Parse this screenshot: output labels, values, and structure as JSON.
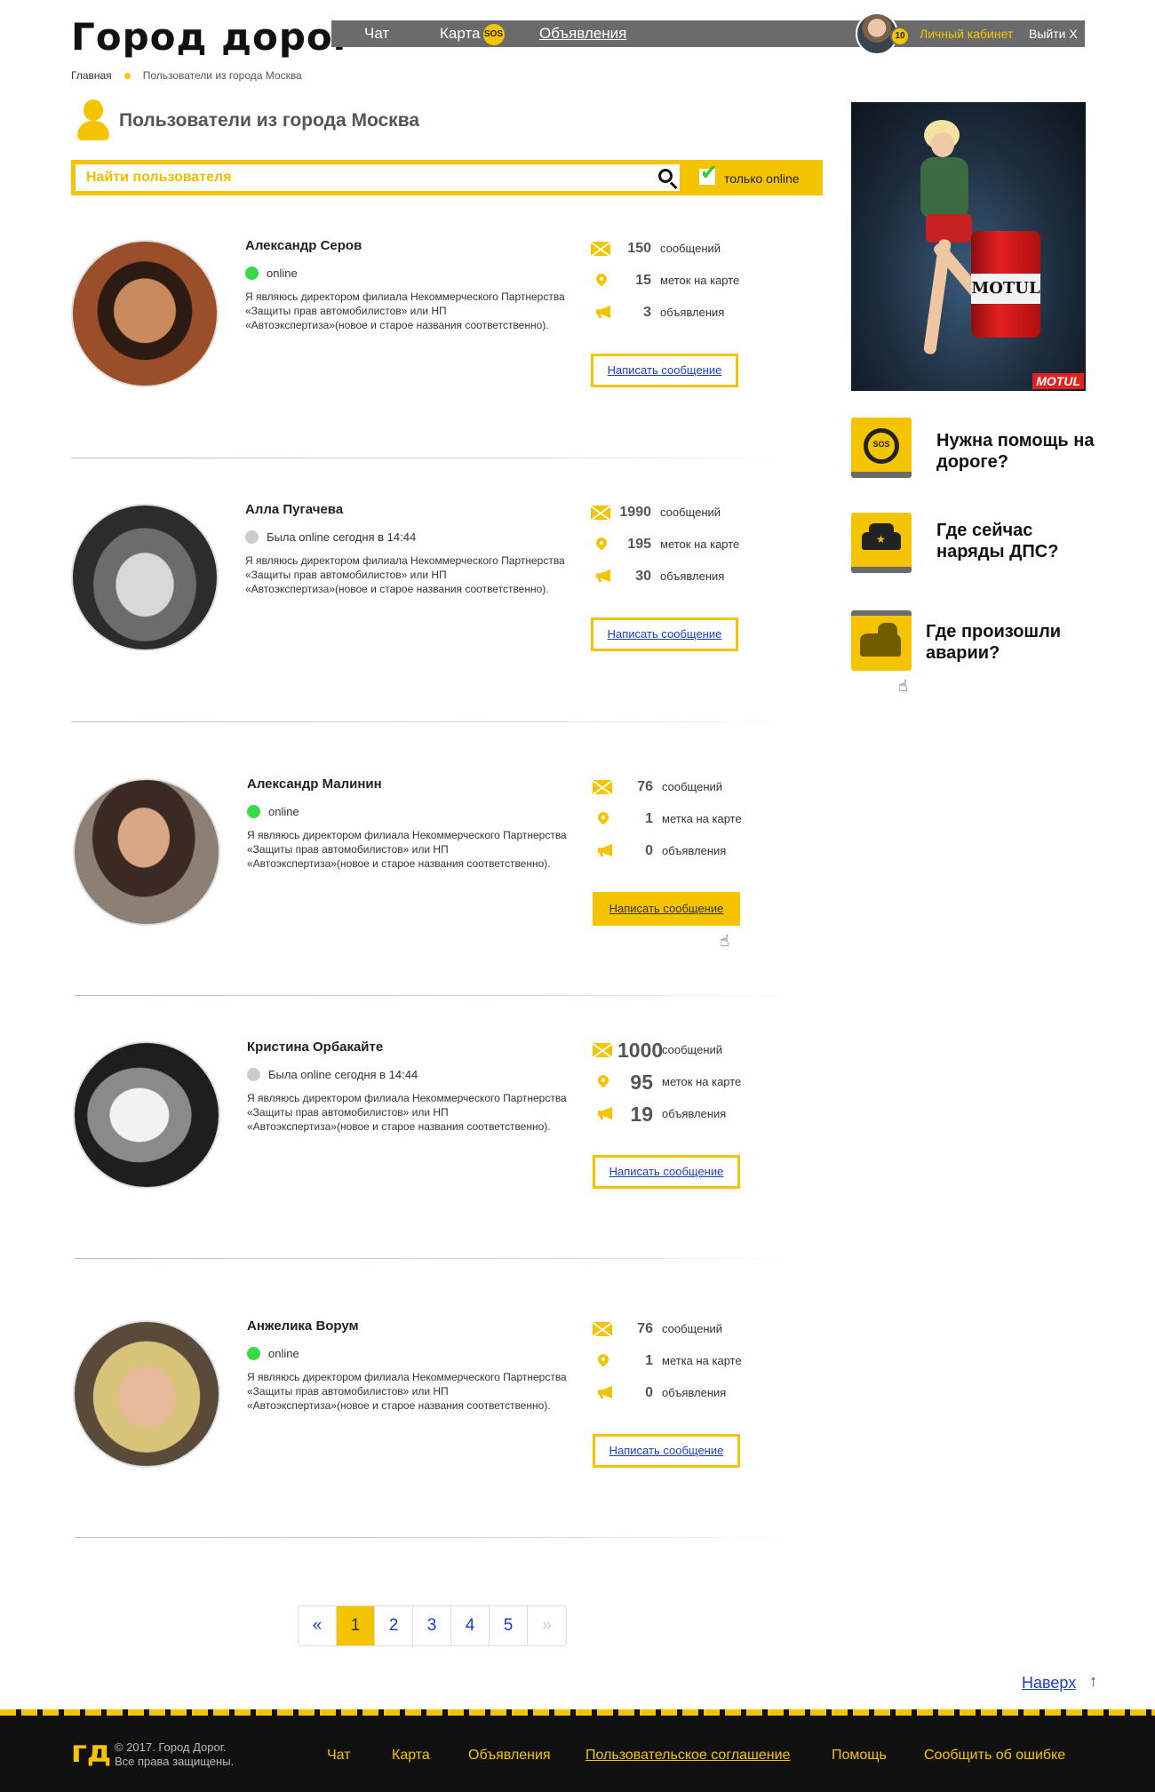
{
  "header": {
    "logo": "Город дорог",
    "nav": [
      {
        "label": "Чат"
      },
      {
        "label": "Карта",
        "badge": "SOS"
      },
      {
        "label": "Объявления"
      }
    ],
    "user": {
      "level": "10",
      "cabinet_label": "Личный кабинет",
      "logout_label": "Выйти Х"
    }
  },
  "breadcrumb": {
    "home": "Главная",
    "current": "Пользователи из города Москва"
  },
  "page_title": "Пользователи из города Москва",
  "search": {
    "placeholder": "Найти пользователя",
    "online_only_label": "только online",
    "online_only_checked": true
  },
  "users": [
    {
      "name": "Александр Серов",
      "status": "online",
      "is_online": true,
      "bio": "Я являюсь директором филиала Некоммерческого Партнерства «Защиты прав автомобилистов» или НП «Автоэкспертиза»(новое и старое названия соответственно).",
      "messages": "150",
      "messages_label": "сообщений",
      "marks": "15",
      "marks_label": "меток на карте",
      "ads": "3",
      "ads_label": "объявления",
      "write_label": "Написать сообщение"
    },
    {
      "name": "Алла Пугачева",
      "status": "Была online сегодня в 14:44",
      "is_online": false,
      "bio": "Я являюсь директором филиала Некоммерческого Партнерства «Защиты прав автомобилистов» или НП «Автоэкспертиза»(новое и старое названия соответственно).",
      "messages": "1990",
      "messages_label": "сообщений",
      "marks": "195",
      "marks_label": "меток на карте",
      "ads": "30",
      "ads_label": "объявления",
      "write_label": "Написать сообщение"
    },
    {
      "name": "Александр Малинин",
      "status": "online",
      "is_online": true,
      "bio": "Я являюсь директором филиала Некоммерческого Партнерства «Защиты прав автомобилистов» или НП «Автоэкспертиза»(новое и старое названия соответственно).",
      "messages": "76",
      "messages_label": "сообщений",
      "marks": "1",
      "marks_label": "метка на карте",
      "ads": "0",
      "ads_label": "объявления",
      "write_label": "Написать сообщение"
    },
    {
      "name": "Кристина Орбакайте",
      "status": "Была online сегодня в 14:44",
      "is_online": false,
      "bio": "Я являюсь директором филиала Некоммерческого Партнерства «Защиты прав автомобилистов» или НП «Автоэкспертиза»(новое и старое названия соответственно).",
      "messages": "1000",
      "messages_label": "сообщений",
      "marks": "95",
      "marks_label": "меток на карте",
      "ads": "19",
      "ads_label": "объявления",
      "write_label": "Написать сообщение"
    },
    {
      "name": "Анжелика Ворум",
      "status": "online",
      "is_online": true,
      "bio": "Я являюсь директором филиала Некоммерческого Партнерства «Защиты прав автомобилистов» или НП «Автоэкспертиза»(новое и старое названия соответственно).",
      "messages": "76",
      "messages_label": "сообщений",
      "marks": "1",
      "marks_label": "метка на карте",
      "ads": "0",
      "ads_label": "объявления",
      "write_label": "Написать сообщение"
    }
  ],
  "sidebar": {
    "ad": {
      "brand": "MOTUL",
      "can_label": "MOTUL"
    },
    "links": [
      {
        "text": "Нужна помощь на дороге?",
        "icon": "steering-wheel-sos-icon",
        "icon_text": "SOS"
      },
      {
        "text": "Где сейчас наряды ДПС?",
        "icon": "police-car-icon"
      },
      {
        "text": "Где произошли аварии?",
        "icon": "car-crash-icon"
      }
    ]
  },
  "pagination": {
    "prev": "«",
    "pages": [
      "1",
      "2",
      "3",
      "4",
      "5"
    ],
    "current": "1",
    "next": "»"
  },
  "to_top": {
    "label": "Наверх",
    "arrow": "↑"
  },
  "footer": {
    "logo": "гд",
    "copyright_line1": "© 2017.  Город Дорог.",
    "copyright_line2": "Все права защищены.",
    "links": [
      "Чат",
      "Карта",
      "Объявления",
      "Пользовательское соглашение",
      "Помощь",
      "Сообщить об ошибке"
    ]
  },
  "colors": {
    "accent": "#f5c400",
    "nav_bg": "#6b6b6b",
    "online": "#39d94a",
    "offline": "#cccccc",
    "link": "#1a3fc7",
    "footer_bg": "#111111"
  }
}
